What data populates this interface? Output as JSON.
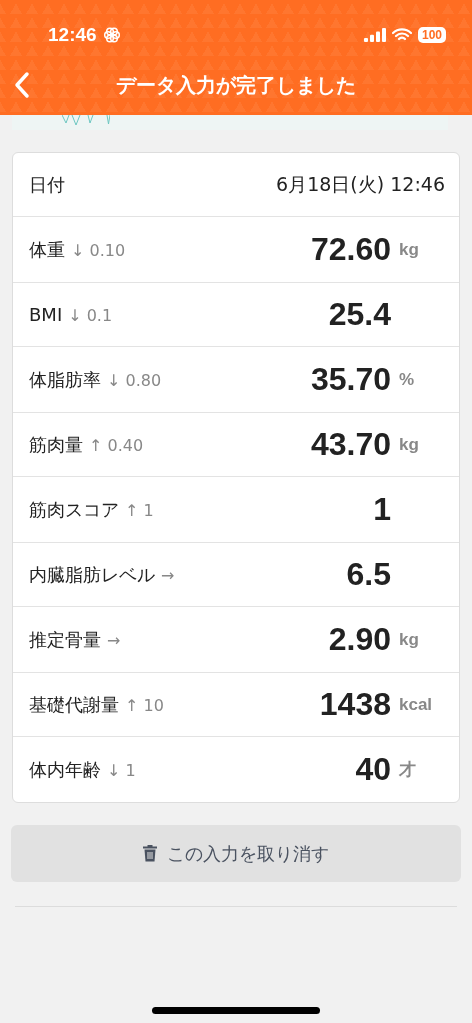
{
  "status_bar": {
    "time": "12:46",
    "battery": "100"
  },
  "header": {
    "title": "データ入力が完了しました"
  },
  "date_row": {
    "label": "日付",
    "value": "6月18日(火) 12:46"
  },
  "measurements": [
    {
      "label": "体重",
      "change": "↓ 0.10",
      "value": "72.60",
      "unit": "kg"
    },
    {
      "label": "BMI",
      "change": "↓ 0.1",
      "value": "25.4"
    },
    {
      "label": "体脂肪率",
      "change": "↓ 0.80",
      "value": "35.70",
      "unit": "%"
    },
    {
      "label": "筋肉量",
      "change": "↑ 0.40",
      "value": "43.70",
      "unit": "kg"
    },
    {
      "label": "筋肉スコア",
      "change": "↑ 1",
      "value": "1"
    },
    {
      "label": "内臓脂肪レベル",
      "change": "→",
      "value": "6.5"
    },
    {
      "label": "推定骨量",
      "change": "→",
      "value": "2.90",
      "unit": "kg"
    },
    {
      "label": "基礎代謝量",
      "change": "↑ 10",
      "value": "1438",
      "unit": "kcal"
    },
    {
      "label": "体内年齢",
      "change": "↓ 1",
      "value": "40",
      "unit": "才"
    }
  ],
  "undo_button": {
    "label": "この入力を取り消す"
  }
}
